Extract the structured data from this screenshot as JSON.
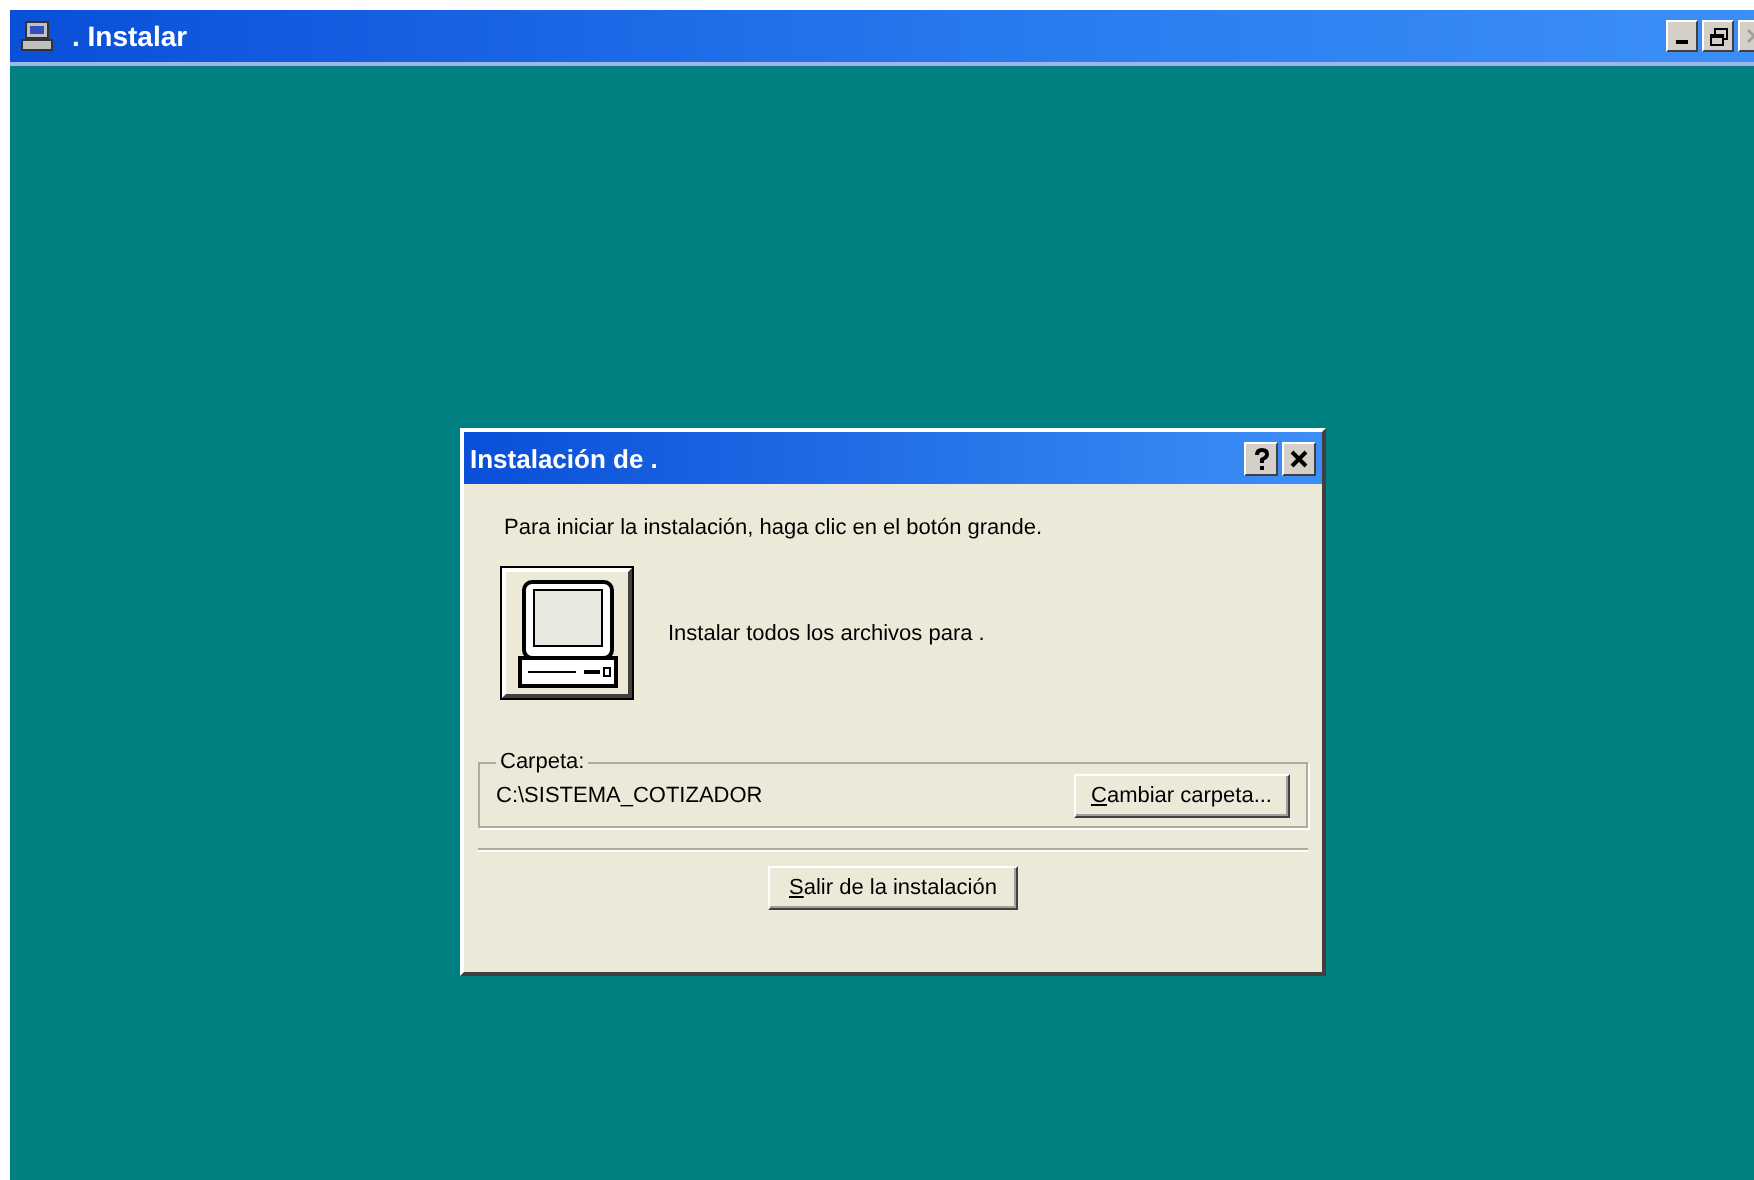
{
  "window": {
    "title": ". Instalar"
  },
  "dialog": {
    "title": "Instalación de .",
    "instruction": "Para iniciar la instalación, haga clic en el botón grande.",
    "install_label": "Instalar todos los archivos para .",
    "folder": {
      "legend": "Carpeta:",
      "path": "C:\\SISTEMA_COTIZADOR",
      "button": "Cambiar carpeta..."
    },
    "exit_button": "Salir de la instalación"
  }
}
